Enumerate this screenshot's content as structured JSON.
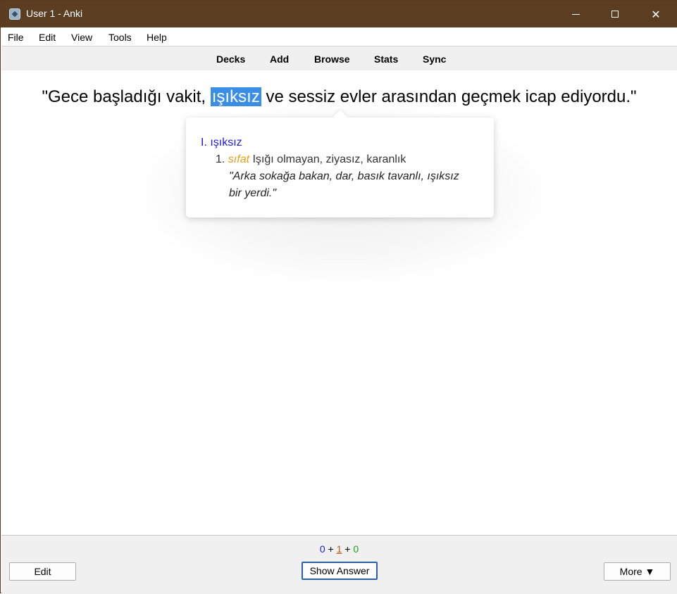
{
  "window": {
    "title": "User 1 - Anki",
    "icon": "anki-app-icon",
    "controls": {
      "minimize": "minimize-icon",
      "maximize": "maximize-icon",
      "close": "✕"
    }
  },
  "menu": [
    "File",
    "Edit",
    "View",
    "Tools",
    "Help"
  ],
  "toolbar": [
    "Decks",
    "Add",
    "Browse",
    "Stats",
    "Sync"
  ],
  "card": {
    "sentence_before": "\"Gece başladığı vakit,",
    "sentence_highlight": "ışıksız",
    "sentence_after": "ve sessiz evler arasından geçmek icap ediyordu.\""
  },
  "popup": {
    "entry_number": "I.",
    "headword": "ışıksız",
    "sense_number": "1.",
    "part_of_speech": "sıfat",
    "definition": "Işığı olmayan, ziyasız, karanlık",
    "example_line1": "\"Arka sokağa bakan, dar, basık tavanlı, ışıksız",
    "example_line2": "bir yerdi.\""
  },
  "counts": {
    "new": "0",
    "learning": "1",
    "review": "0",
    "plus": "+"
  },
  "buttons": {
    "edit": "Edit",
    "show_answer": "Show Answer",
    "more": "More ▼"
  },
  "colors": {
    "titlebar": "#5b3d22",
    "highlight": "#3a8ee6",
    "headword": "#1a1adb",
    "pos": "#e6a117"
  }
}
